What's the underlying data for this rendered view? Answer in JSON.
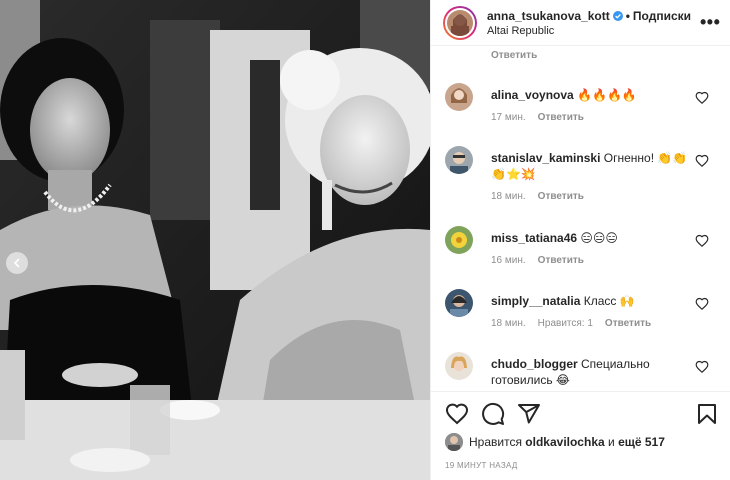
{
  "header": {
    "username": "anna_tsukanova_kott",
    "follow_label": "Подписки",
    "location": "Altai Republic",
    "more_label": "•••"
  },
  "comments": {
    "prev_reply_label": "Ответить",
    "items": [
      {
        "user": "alina_voynova",
        "text": "🔥🔥🔥🔥",
        "time": "17 мин.",
        "likes": "",
        "reply": "Ответить"
      },
      {
        "user": "stanislav_kaminski",
        "text": "Огненно! 👏👏👏⭐💥",
        "time": "18 мин.",
        "likes": "",
        "reply": "Ответить"
      },
      {
        "user": "miss_tatiana46",
        "text": "😑😑😑",
        "time": "16 мин.",
        "likes": "",
        "reply": "Ответить"
      },
      {
        "user": "simply__natalia",
        "text": "Класс 🙌",
        "time": "18 мин.",
        "likes": "Нравится: 1",
        "reply": "Ответить"
      },
      {
        "user": "chudo_blogger",
        "text": "Специально готовились 😂",
        "time": "",
        "likes": "",
        "reply": ""
      }
    ]
  },
  "likes": {
    "prefix": "Нравится",
    "user": "oldkavilochka",
    "connector": "и",
    "rest": "ещё 517"
  },
  "timeago": "19 МИНУТ НАЗАД",
  "icons": {
    "verified": "verified-badge-icon",
    "like": "heart-icon",
    "comment": "comment-icon",
    "share": "share-icon",
    "save": "bookmark-icon",
    "carousel_prev": "chevron-left-icon"
  },
  "colors": {
    "verified": "#3897f0",
    "text": "#262626",
    "muted": "#8e8e8e",
    "border": "#efefef"
  }
}
